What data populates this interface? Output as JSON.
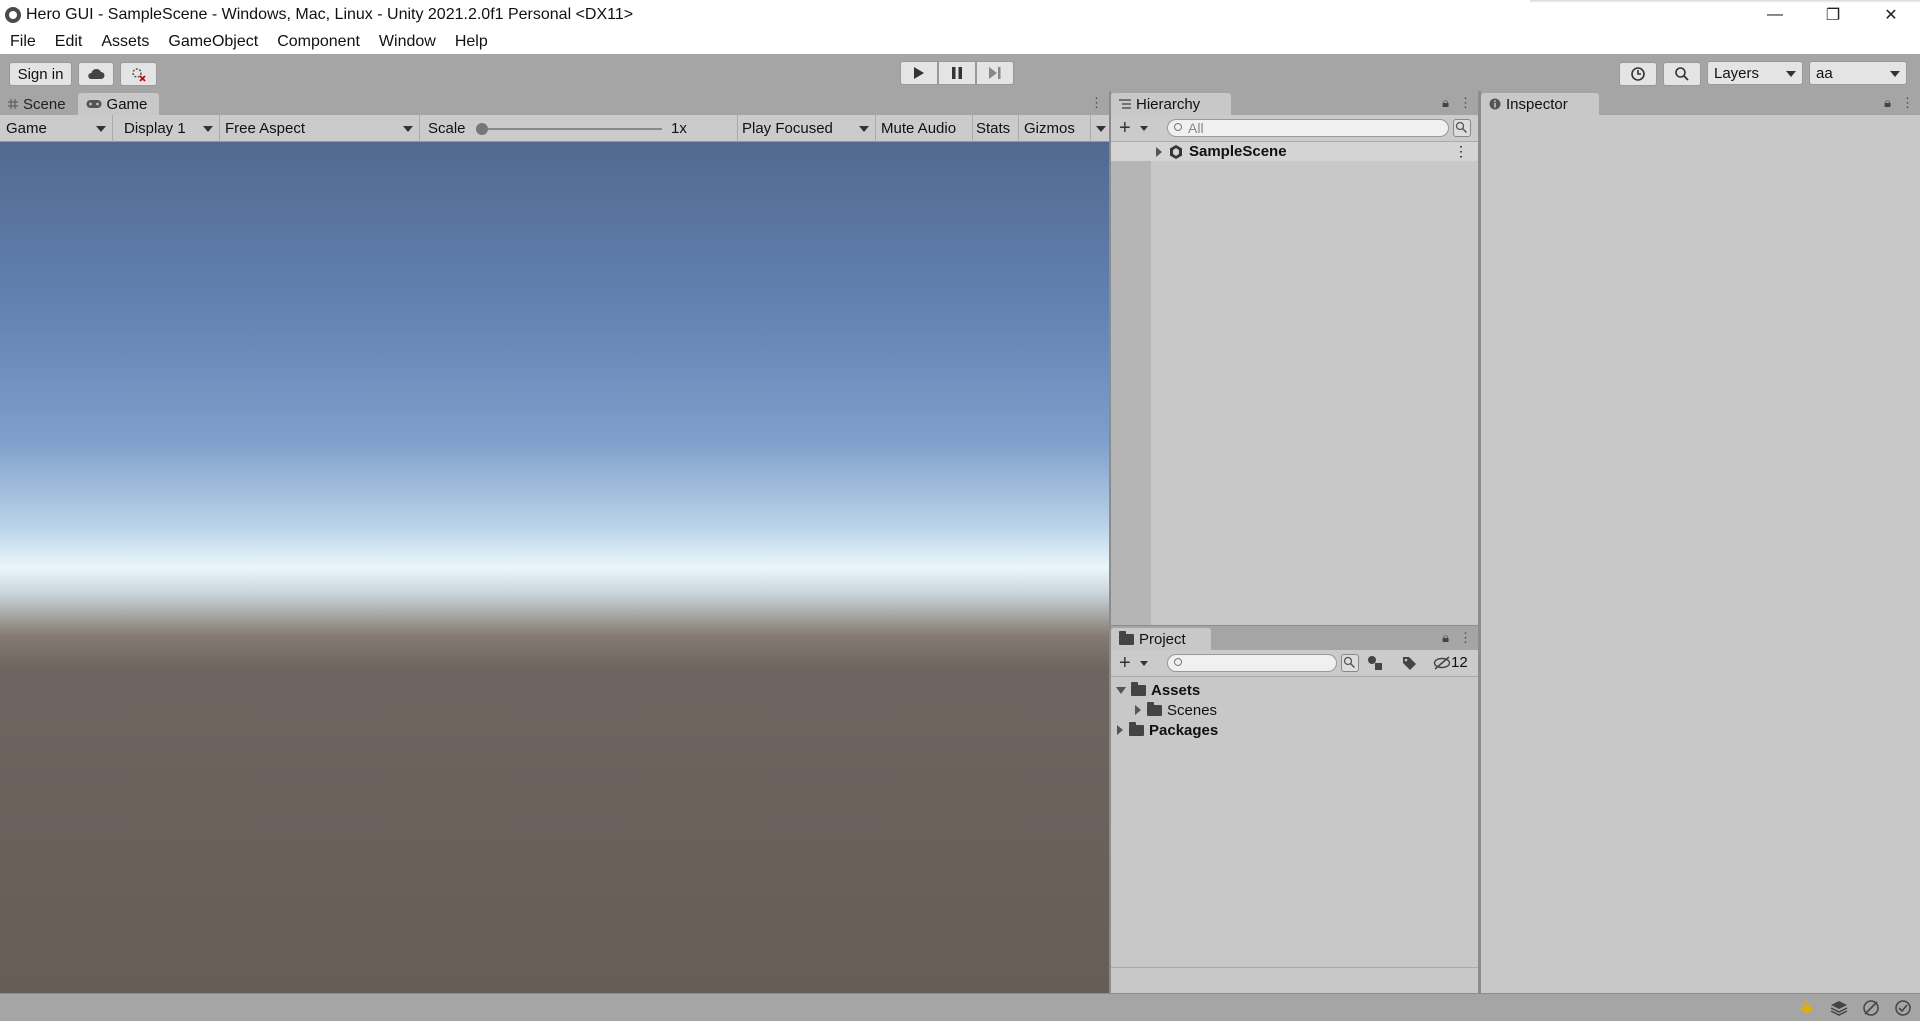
{
  "window": {
    "title": "Hero GUI - SampleScene - Windows, Mac, Linux - Unity 2021.2.0f1 Personal <DX11>",
    "minimize": "—",
    "restore": "❐",
    "close": "✕"
  },
  "menu": [
    "File",
    "Edit",
    "Assets",
    "GameObject",
    "Component",
    "Window",
    "Help"
  ],
  "toolbar": {
    "sign_in": "Sign in",
    "layers": "Layers",
    "layout": "aa"
  },
  "scene_tabs": [
    {
      "label": "Scene",
      "icon": "grid-icon"
    },
    {
      "label": "Game",
      "icon": "gamepad-icon"
    }
  ],
  "game_toolbar": {
    "mode": "Game",
    "display": "Display 1",
    "aspect": "Free Aspect",
    "scale_label": "Scale",
    "scale_value": "1x",
    "play_mode": "Play Focused",
    "mute": "Mute Audio",
    "stats": "Stats",
    "gizmos": "Gizmos"
  },
  "hierarchy": {
    "tab": "Hierarchy",
    "search_placeholder": "All",
    "scene": "SampleScene"
  },
  "project": {
    "tab": "Project",
    "hidden_count": "12",
    "tree": {
      "assets": "Assets",
      "scenes": "Scenes",
      "packages": "Packages"
    }
  },
  "inspector": {
    "tab": "Inspector"
  }
}
